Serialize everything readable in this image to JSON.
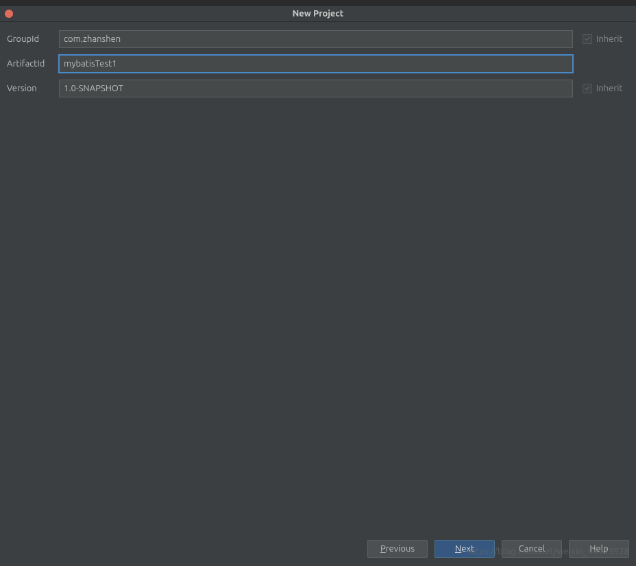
{
  "window": {
    "title": "New Project"
  },
  "form": {
    "groupId": {
      "label": "GroupId",
      "value": "com.zhanshen",
      "inheritLabel": "Inherit",
      "inheritChecked": true
    },
    "artifactId": {
      "label": "ArtifactId",
      "value": "mybatisTest1"
    },
    "version": {
      "label": "Version",
      "value": "1.0-SNAPSHOT",
      "inheritLabel": "Inherit",
      "inheritChecked": true
    }
  },
  "buttons": {
    "previous": "Previous",
    "next": "Next",
    "cancel": "Cancel",
    "help": "Help"
  },
  "watermark": "https://blog.csdn.net/weixin_44413928"
}
